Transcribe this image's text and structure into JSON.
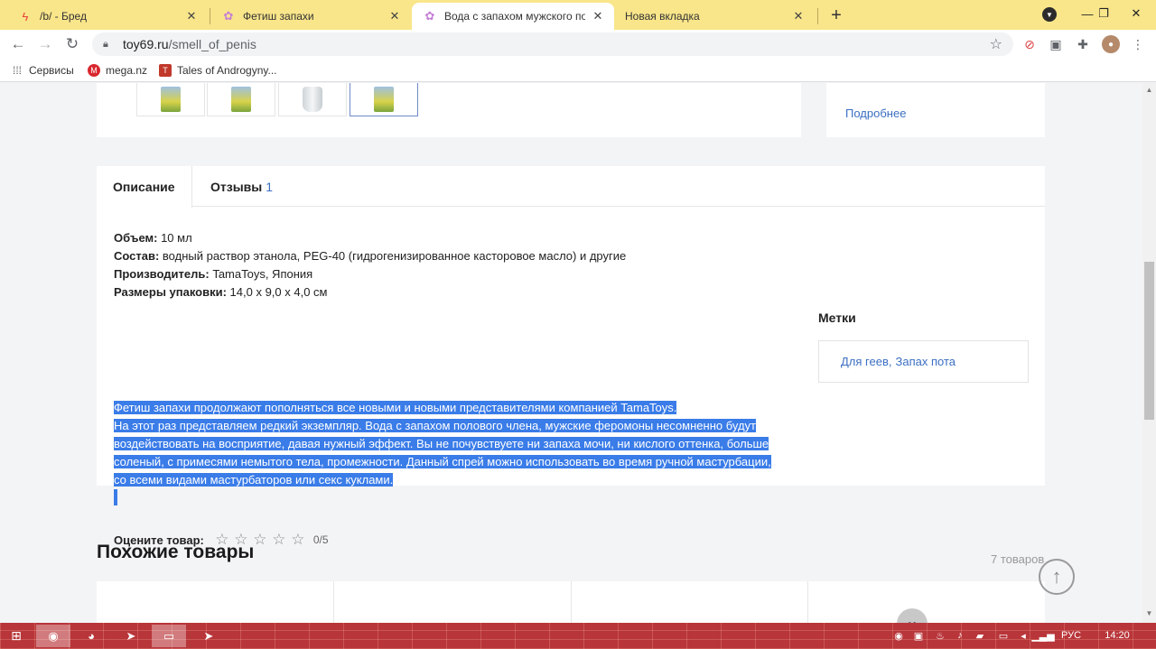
{
  "browser": {
    "tabs": [
      {
        "title": "/b/ - Бред",
        "icon": "lightning-icon",
        "active": false
      },
      {
        "title": "Фетиш запахи",
        "icon": "site-logo-icon",
        "active": false
      },
      {
        "title": "Вода с запахом мужского поло",
        "icon": "site-logo-icon",
        "active": true
      },
      {
        "title": "Новая вкладка",
        "icon": "",
        "active": false
      }
    ],
    "url_host": "toy69.ru",
    "url_path": "/smell_of_penis",
    "bookmarks": [
      {
        "label": "Сервисы",
        "icon": "apps-grid-icon"
      },
      {
        "label": "mega.nz",
        "icon": "mega-icon"
      },
      {
        "label": "Tales of Androgyny...",
        "icon": "game-icon"
      }
    ]
  },
  "top": {
    "more_link": "Подробнее"
  },
  "description": {
    "tab_desc": "Описание",
    "tab_reviews": "Отзывы",
    "reviews_count": "1",
    "specs": [
      {
        "label": "Объем:",
        "value": " 10 мл"
      },
      {
        "label": "Состав:",
        "value": " водный раствор этанола, PEG-40 (гидрогенизированное касторовое масло) и другие"
      },
      {
        "label": "Производитель:",
        "value": " TamaToys, Япония"
      },
      {
        "label": "Размеры упаковки:",
        "value": " 14,0 х 9,0 х 4,0 см"
      }
    ],
    "selected_lines": [
      "Фетиш запахи продолжают пополняться все новыми и новыми представителями компанией TamaToys.",
      "На этот раз представляем редкий экземпляр. Вода с запахом полового члена, мужские феромоны несомненно будут",
      "воздействовать на восприятие, давая нужный эффект. Вы не почувствуете ни запаха мочи, ни кислого оттенка, больше",
      "соленый, с примесями немытого тела, промежности. Данный спрей можно использовать во время ручной мастурбации,",
      "со всеми видами мастурбаторов или секс куклами."
    ],
    "rate_label": "Оцените товар:",
    "rate_score": "0/5",
    "rating": 0
  },
  "tags": {
    "title": "Метки",
    "items": [
      "Для геев",
      "Запах пота"
    ]
  },
  "similar": {
    "title": "Похожие товары",
    "count": "7 товаров"
  },
  "taskbar": {
    "lang": "РУС",
    "time": "14:20"
  },
  "colors": {
    "tabstrip": "#f9e58a",
    "link": "#3b6fc2",
    "selection": "#3a7ce8",
    "taskbar": "#b8353a"
  }
}
